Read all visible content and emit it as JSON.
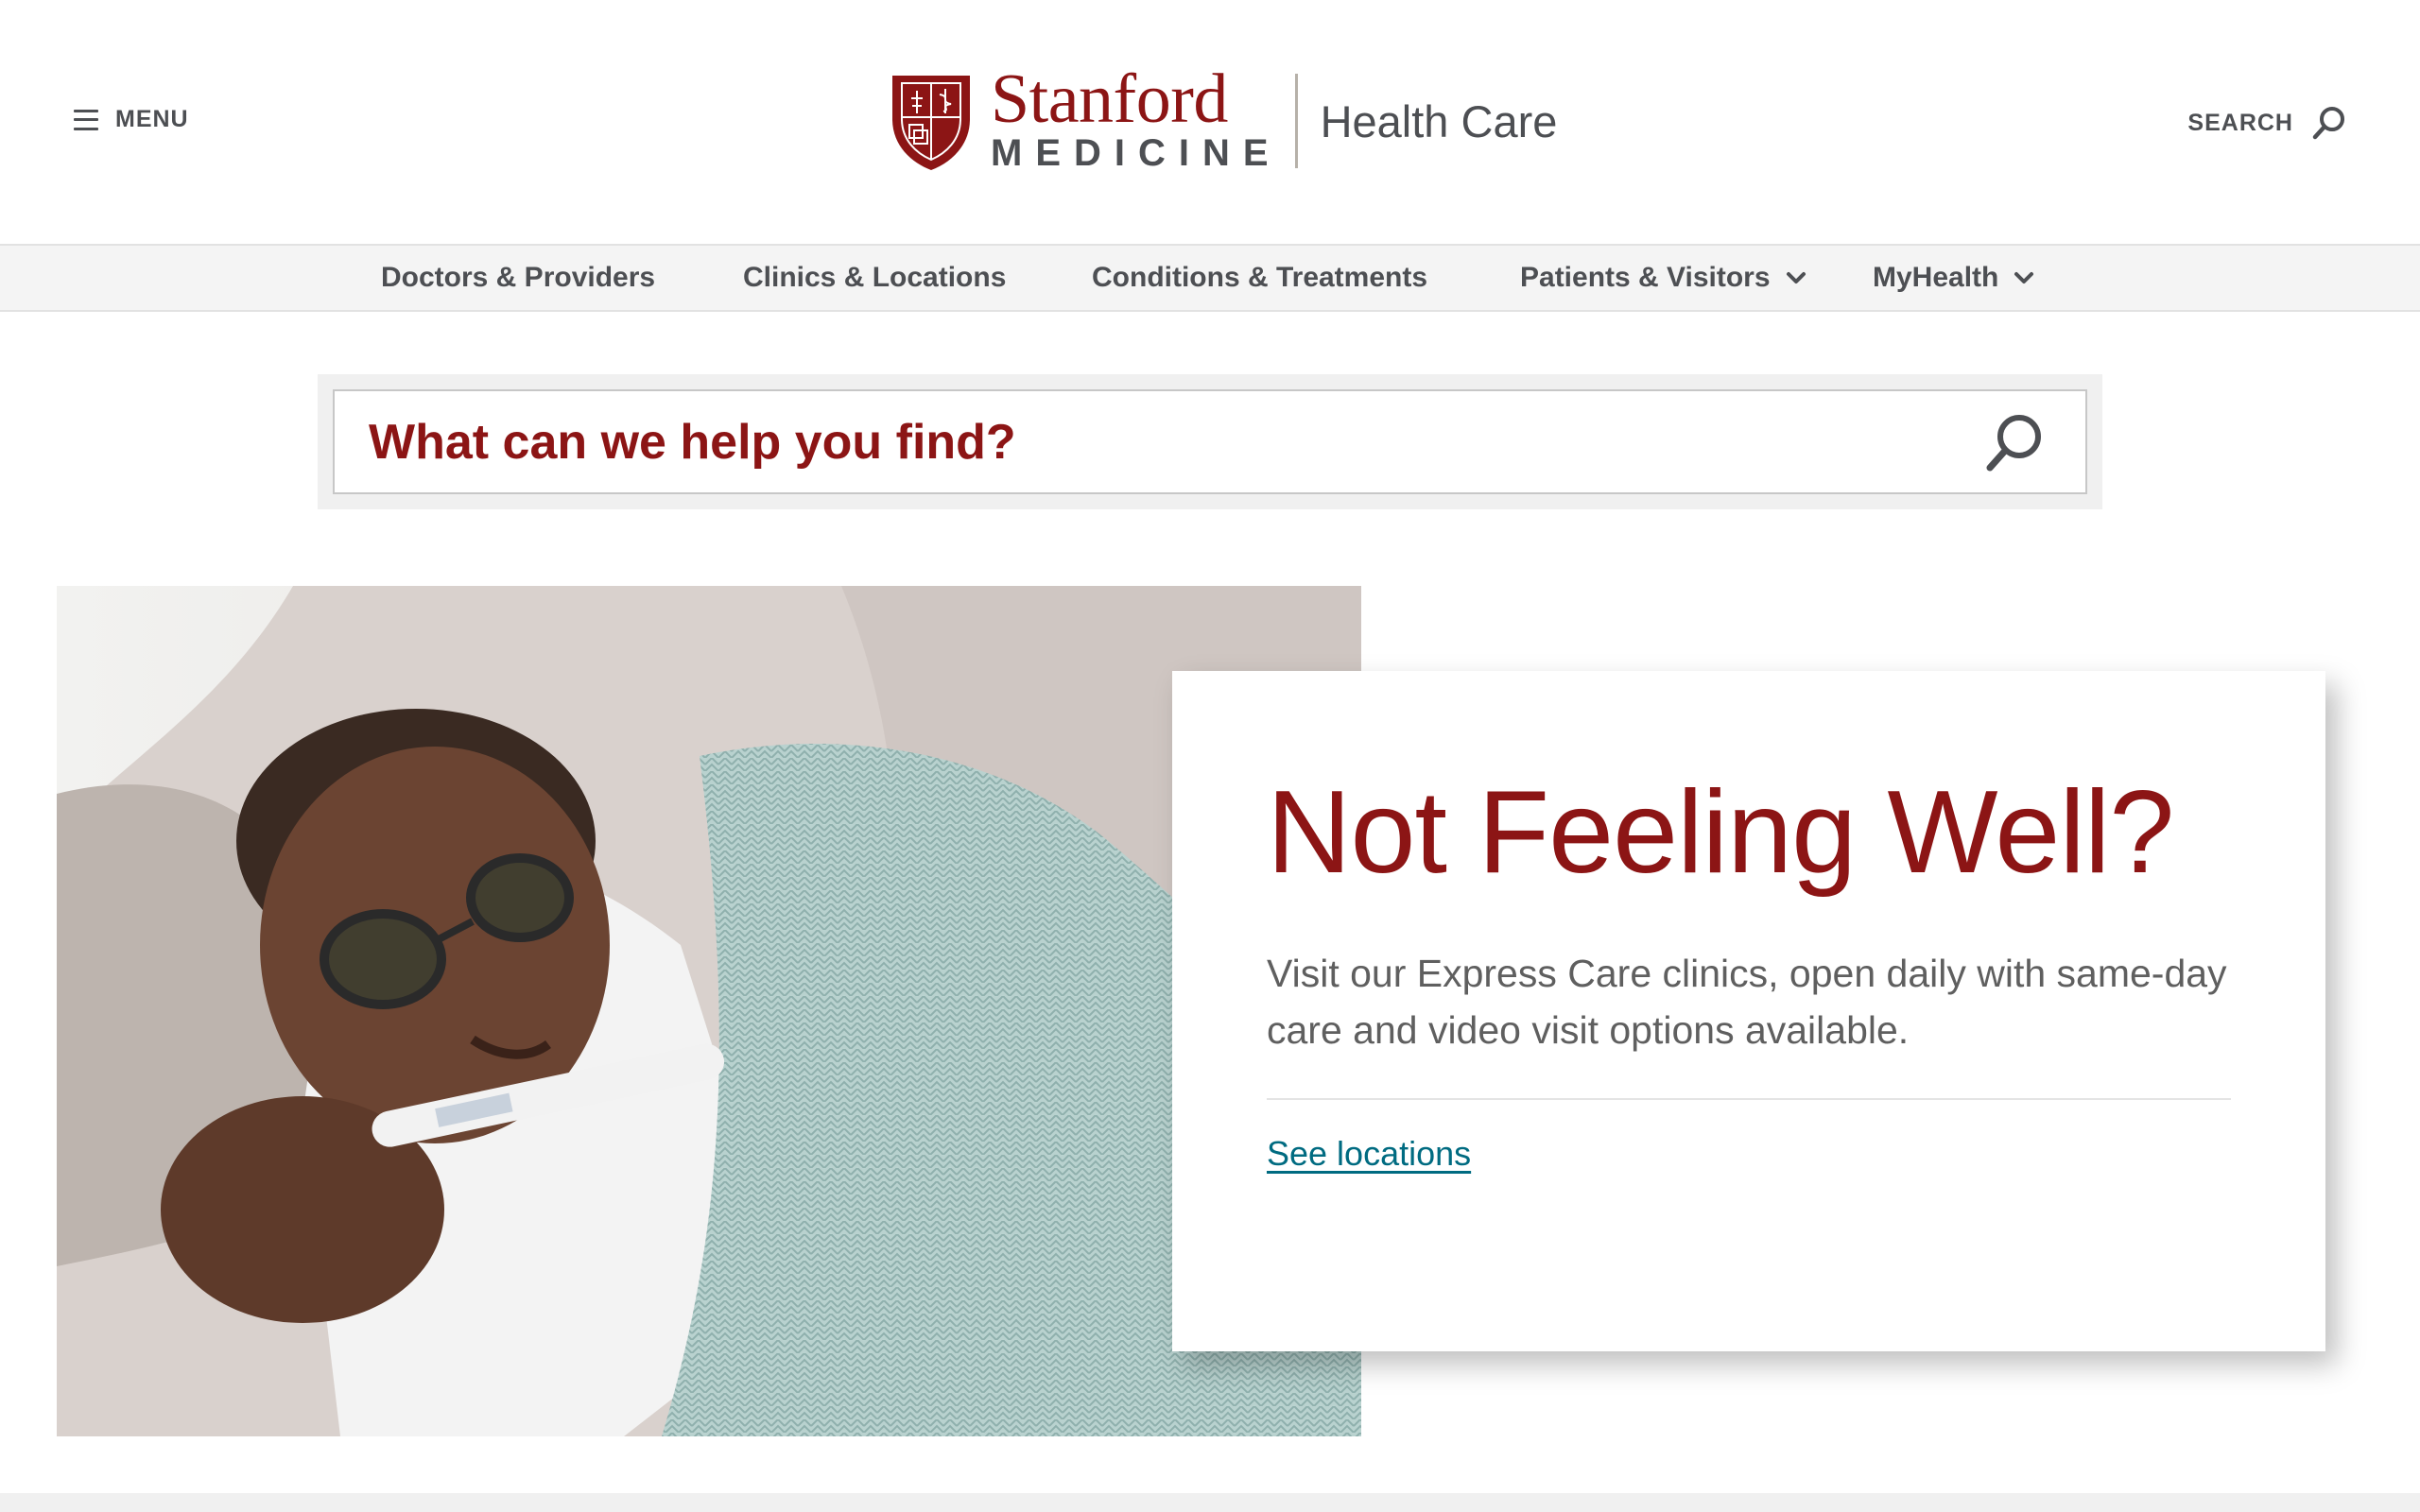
{
  "header": {
    "menu_label": "MENU",
    "brand_stanford": "Stanford",
    "brand_medicine": "MEDICINE",
    "brand_sub": "Health Care",
    "search_label": "SEARCH"
  },
  "nav": {
    "items": [
      {
        "label": "Doctors & Providers",
        "has_dropdown": false
      },
      {
        "label": "Clinics & Locations",
        "has_dropdown": false
      },
      {
        "label": "Conditions & Treatments",
        "has_dropdown": false
      },
      {
        "label": "Patients & Visitors",
        "has_dropdown": true
      },
      {
        "label": "MyHealth",
        "has_dropdown": true
      }
    ]
  },
  "search": {
    "placeholder": "What can we help you find?"
  },
  "hero": {
    "title": "Not Feeling Well?",
    "text": "Visit our Express Care clinics, open daily with same-day care and video visit options available.",
    "link_label": "See locations"
  },
  "colors": {
    "brand_red": "#8c1515",
    "text_gray": "#4d4f53",
    "link_teal": "#006b81",
    "nav_bg": "#f4f4f4"
  }
}
